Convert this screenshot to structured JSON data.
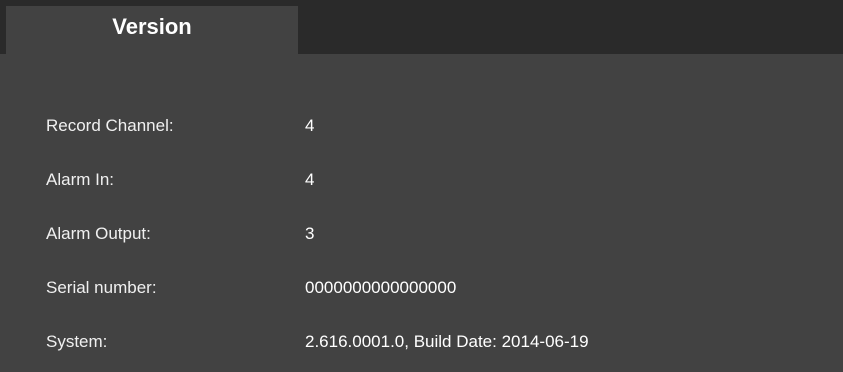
{
  "tabs": [
    {
      "label": "Version"
    }
  ],
  "info_rows": [
    {
      "label": "Record Channel:",
      "value": "4"
    },
    {
      "label": "Alarm In:",
      "value": "4"
    },
    {
      "label": "Alarm Output:",
      "value": "3"
    },
    {
      "label": "Serial number:",
      "value": "0000000000000000"
    },
    {
      "label": "System:",
      "value": "2.616.0001.0, Build Date: 2014-06-19"
    }
  ],
  "colors": {
    "panel_background": "#424242",
    "tab_bar_background": "#2a2a2a",
    "text": "#ffffff"
  }
}
